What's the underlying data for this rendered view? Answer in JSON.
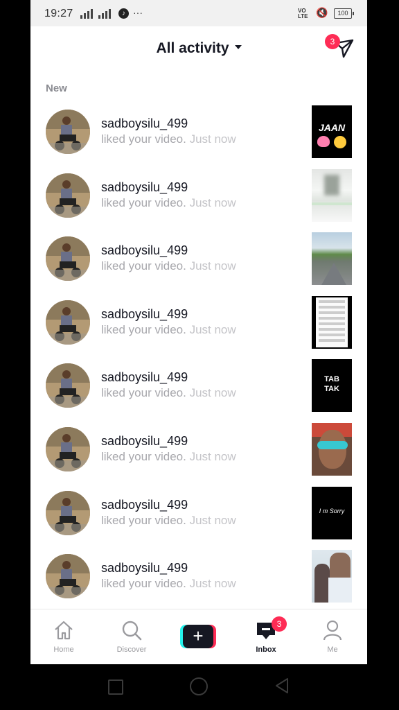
{
  "status_bar": {
    "time": "19:27",
    "network_label": "4G",
    "overflow": "···",
    "volte": "VO\nLTE",
    "battery": "100"
  },
  "header": {
    "title": "All activity",
    "send_badge": "3"
  },
  "section_label": "New",
  "notifications": [
    {
      "username": "sadboysilu_499",
      "action": "liked your video.",
      "time": "Just now",
      "thumb_text": "JAAN"
    },
    {
      "username": "sadboysilu_499",
      "action": "liked your video.",
      "time": "Just now",
      "thumb_text": ""
    },
    {
      "username": "sadboysilu_499",
      "action": "liked your video.",
      "time": "Just now",
      "thumb_text": ""
    },
    {
      "username": "sadboysilu_499",
      "action": "liked your video.",
      "time": "Just now",
      "thumb_text": ""
    },
    {
      "username": "sadboysilu_499",
      "action": "liked your video.",
      "time": "Just now",
      "thumb_text": "TAB TAK"
    },
    {
      "username": "sadboysilu_499",
      "action": "liked your video.",
      "time": "Just now",
      "thumb_text": ""
    },
    {
      "username": "sadboysilu_499",
      "action": "liked your video.",
      "time": "Just now",
      "thumb_text": "I m Sorry"
    },
    {
      "username": "sadboysilu_499",
      "action": "liked your video.",
      "time": "Just now",
      "thumb_text": ""
    }
  ],
  "tabs": [
    {
      "label": "Home",
      "icon": "home-icon"
    },
    {
      "label": "Discover",
      "icon": "search-icon"
    },
    {
      "label": "",
      "icon": "plus-icon"
    },
    {
      "label": "Inbox",
      "icon": "inbox-icon",
      "badge": "3"
    },
    {
      "label": "Me",
      "icon": "profile-icon"
    }
  ],
  "colors": {
    "accent": "#fe2c55",
    "cyan": "#25f4ee",
    "text": "#161823",
    "muted": "#a8a8ad"
  }
}
